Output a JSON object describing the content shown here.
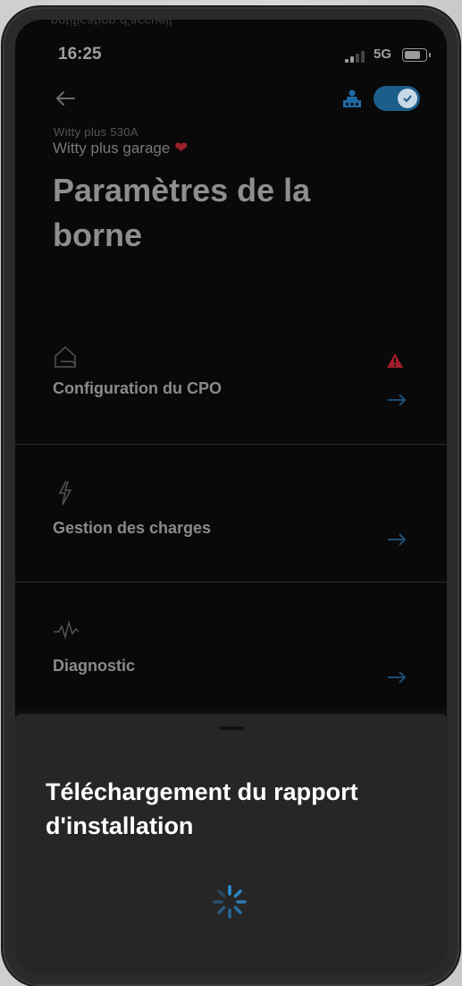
{
  "background": {
    "mirrored_text": "notification d'accueil"
  },
  "status_bar": {
    "time": "16:25",
    "network": "5G"
  },
  "header": {
    "overline": "Witty plus 530A",
    "subtitle": "Witty plus garage",
    "title": "Paramètres de la borne",
    "toggle_on": true
  },
  "menu": {
    "items": [
      {
        "icon": "house-charger-icon",
        "label": "Configuration du CPO",
        "warning": true
      },
      {
        "icon": "lightning-icon",
        "label": "Gestion des charges",
        "warning": false
      },
      {
        "icon": "pulse-icon",
        "label": "Diagnostic",
        "warning": false
      }
    ]
  },
  "sheet": {
    "title": "Téléchargement du rapport d'installation",
    "status": "loading"
  },
  "colors": {
    "accent": "#1b5e8a",
    "spinner": "#2e8fd6",
    "warning": "#a01f2b"
  }
}
